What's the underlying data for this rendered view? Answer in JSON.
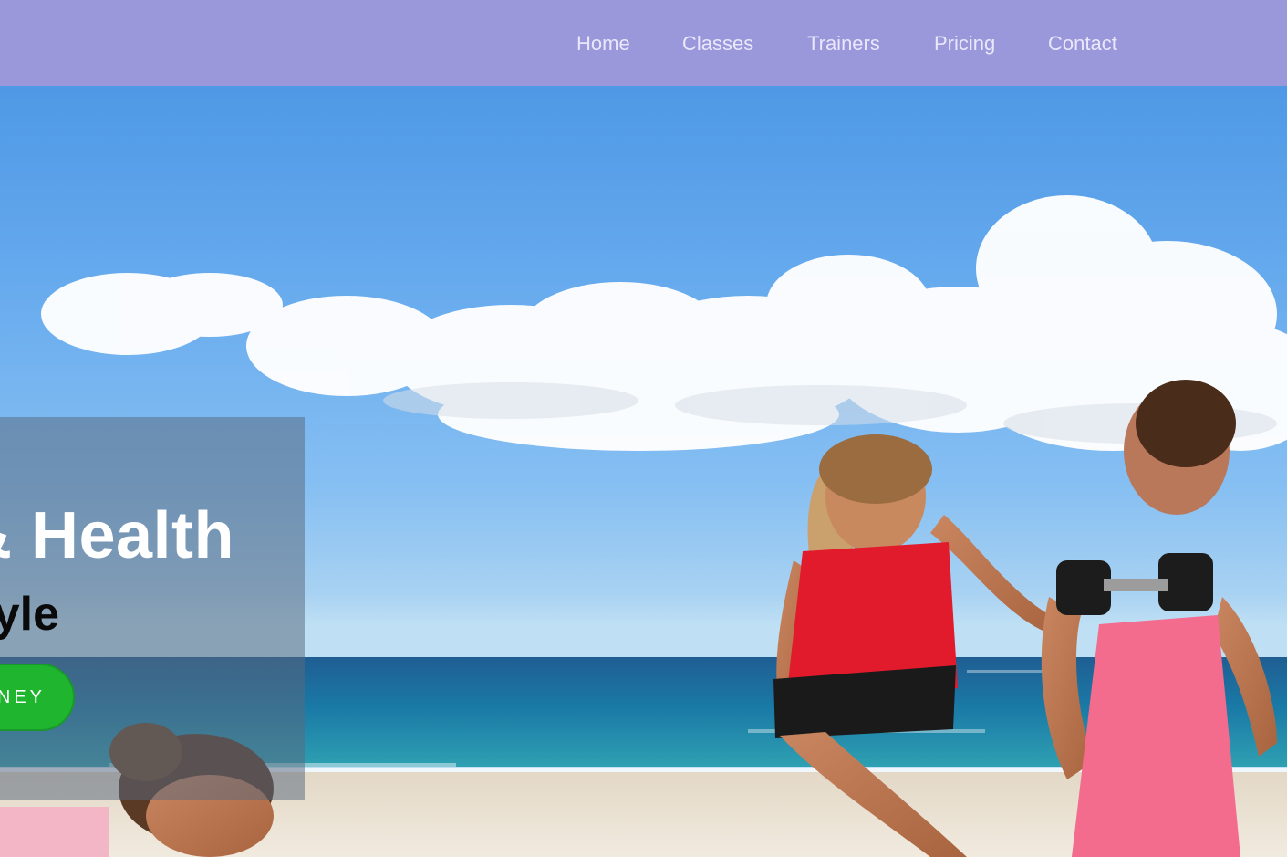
{
  "nav": {
    "items": [
      {
        "label": "Home"
      },
      {
        "label": "Classes"
      },
      {
        "label": "Trainers"
      },
      {
        "label": "Pricing"
      },
      {
        "label": "Contact"
      }
    ],
    "background_color": "#9a97da",
    "link_color": "#e9e7fb"
  },
  "hero": {
    "title": "& Health",
    "subtitle": "yle",
    "cta_label": "NEY",
    "cta_color": "#1fb52f"
  }
}
